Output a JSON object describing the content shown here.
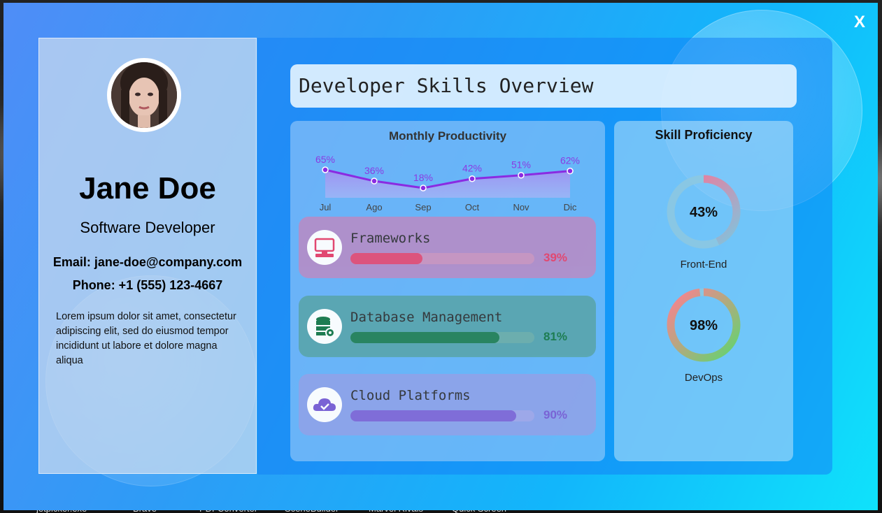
{
  "taskbar": [
    "jetpicker.exe",
    "Brave",
    "PDFConverter",
    "SceneBuilder",
    "Marvel Rivals",
    "Quick Screen"
  ],
  "window": {
    "close_label": "X"
  },
  "profile": {
    "name": "Jane Doe",
    "role": "Software Developer",
    "email": "Email: jane-doe@company.com",
    "phone": "Phone: +1 (555) 123-4667",
    "bio": "Lorem ipsum dolor sit amet, consectetur adipiscing elit, sed do eiusmod tempor incididunt ut labore et dolore magna aliqua"
  },
  "dashboard": {
    "title": "Developer Skills Overview"
  },
  "chart_data": {
    "type": "area",
    "title": "Monthly Productivity",
    "categories": [
      "Jul",
      "Ago",
      "Sep",
      "Oct",
      "Nov",
      "Dic"
    ],
    "values": [
      65,
      36,
      18,
      42,
      51,
      62
    ],
    "data_labels": [
      "65%",
      "36%",
      "18%",
      "42%",
      "51%",
      "62%"
    ],
    "color": "#8a2be2"
  },
  "skills": [
    {
      "name": "Frameworks",
      "value": 39,
      "label": "39%",
      "icon": "monitor-icon",
      "color": "#e8436a",
      "row_bg": "#b28fc9"
    },
    {
      "name": "Database Management",
      "value": 81,
      "label": "81%",
      "icon": "database-gear-icon",
      "color": "#1a7a4a",
      "row_bg": "#5aa6b0"
    },
    {
      "name": "Cloud Platforms",
      "value": 90,
      "label": "90%",
      "icon": "cloud-check-icon",
      "color": "#7b5fd4",
      "row_bg": "#8da4ea"
    }
  ],
  "proficiency": {
    "title": "Skill Proficiency",
    "items": [
      {
        "label": "Front-End",
        "value": 43,
        "text": "43%",
        "colors": [
          "#ff6f91",
          "#7cc6e0"
        ]
      },
      {
        "label": "DevOps",
        "value": 98,
        "text": "98%",
        "colors": [
          "#ff7f90",
          "#5fd66f"
        ]
      }
    ]
  }
}
